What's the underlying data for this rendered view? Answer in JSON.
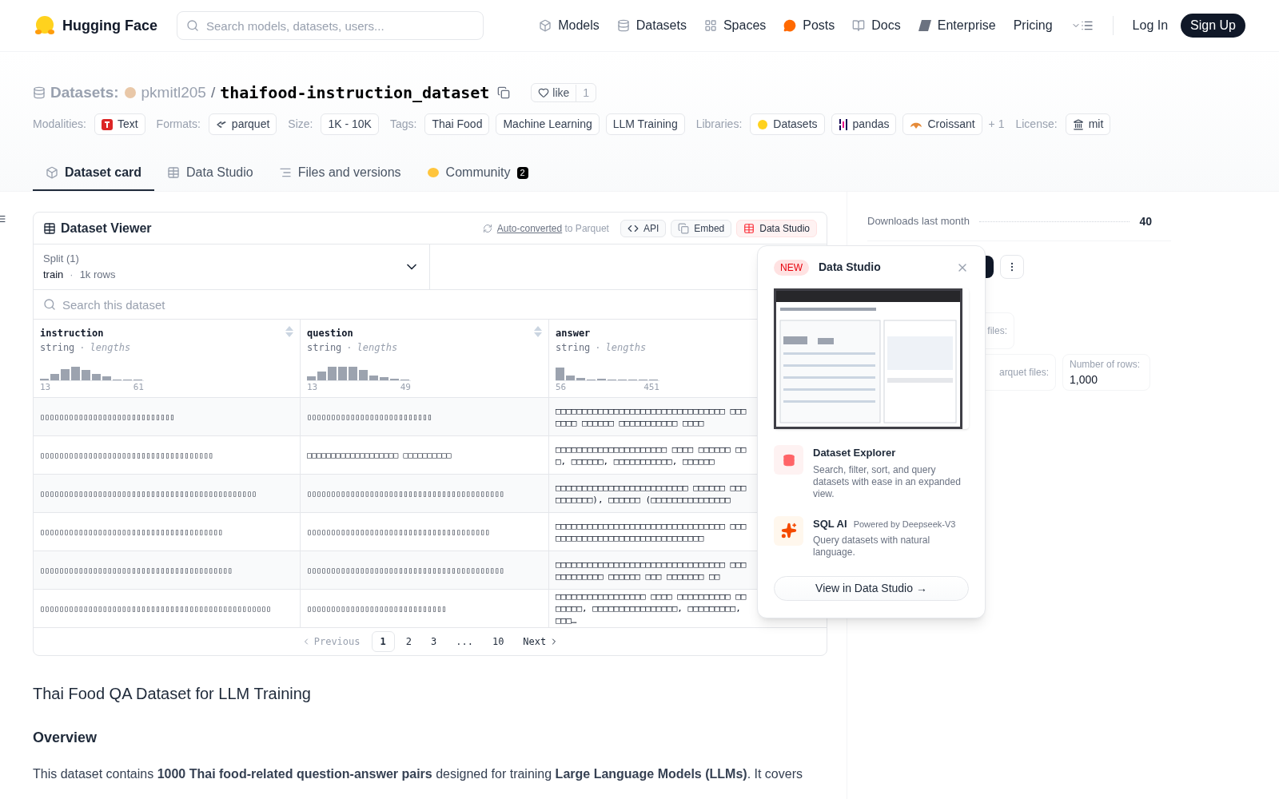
{
  "header": {
    "logo_text": "Hugging Face",
    "search_placeholder": "Search models, datasets, users...",
    "nav": [
      {
        "label": "Models",
        "kind": "models"
      },
      {
        "label": "Datasets",
        "kind": "datasets"
      },
      {
        "label": "Spaces",
        "kind": "spaces"
      },
      {
        "label": "Posts",
        "kind": "posts"
      },
      {
        "label": "Docs",
        "kind": "docs"
      },
      {
        "label": "Enterprise",
        "kind": "enterprise"
      },
      {
        "label": "Pricing",
        "kind": "plain"
      }
    ],
    "login": "Log In",
    "signup": "Sign Up"
  },
  "repo": {
    "category": "Datasets:",
    "owner": "pkmitl205",
    "separator": "/",
    "name": "thaifood-instruction_dataset",
    "like_label": "like",
    "like_count": "1"
  },
  "meta": [
    {
      "label": "Modalities:",
      "tags": [
        {
          "text": "Text",
          "kind": "text"
        }
      ]
    },
    {
      "label": "Formats:",
      "tags": [
        {
          "text": "parquet",
          "kind": "parquet"
        }
      ]
    },
    {
      "label": "Size:",
      "tags": [
        {
          "text": "1K - 10K",
          "kind": "plain"
        }
      ]
    },
    {
      "label": "Tags:",
      "tags": [
        {
          "text": "Thai Food",
          "kind": "plain"
        },
        {
          "text": "Machine Learning",
          "kind": "plain"
        },
        {
          "text": "LLM Training",
          "kind": "plain"
        }
      ]
    },
    {
      "label": "Libraries:",
      "tags": [
        {
          "text": "Datasets",
          "kind": "hf"
        },
        {
          "text": "pandas",
          "kind": "pandas"
        },
        {
          "text": "Croissant",
          "kind": "croissant"
        }
      ],
      "more": "+ 1"
    },
    {
      "label": "License:",
      "tags": [
        {
          "text": "mit",
          "kind": "license"
        }
      ]
    }
  ],
  "tabs": [
    {
      "label": "Dataset card",
      "kind": "card",
      "selected": true
    },
    {
      "label": "Data Studio",
      "kind": "studio",
      "selected": false
    },
    {
      "label": "Files and versions",
      "kind": "files",
      "selected": false
    },
    {
      "label": "Community",
      "kind": "community",
      "selected": false,
      "badge": "2"
    }
  ],
  "viewer": {
    "title": "Dataset Viewer",
    "converted_link": "Auto-converted",
    "converted_rest": "to Parquet",
    "buttons": [
      {
        "label": "API",
        "kind": "api"
      },
      {
        "label": "Embed",
        "kind": "embed"
      },
      {
        "label": "Data Studio",
        "kind": "studio"
      }
    ],
    "split": {
      "label": "Split (1)",
      "value": "train",
      "separator": "·",
      "rows": "1k rows"
    },
    "search_placeholder": "Search this dataset",
    "columns": [
      {
        "name": "instruction",
        "type": "string",
        "separator": "·",
        "stat": "lengths",
        "min": "13",
        "max": "61"
      },
      {
        "name": "question",
        "type": "string",
        "separator": "·",
        "stat": "lengths",
        "min": "13",
        "max": "49"
      },
      {
        "name": "answer",
        "type": "string",
        "separator": "·",
        "stat": "lengths",
        "min": "56",
        "max": "451"
      }
    ],
    "rows": [
      {
        "cells": [
          "▯▯▯▯▯▯▯▯▯▯▯▯▯▯▯▯▯▯▯▯▯▯▯▯▯▯▯▯",
          "▯▯▯▯▯▯▯▯▯▯▯▯▯▯▯▯▯▯▯▯▯▯▯▯▯▯",
          "□□□□□□□□□□□□□□□□□□□□□□□□□□□□□□□□ □□□□□□□ □□□□□□ □□□□□□□□□□□ □□□□"
        ]
      },
      {
        "cells": [
          "▯▯▯▯▯▯▯▯▯▯▯▯▯▯▯▯▯▯▯▯▯▯▯▯▯▯▯▯▯▯▯▯▯▯▯▯",
          "□□□□□□□□□□□□□□□□□□□ □□□□□□□□□□",
          "□□□□□□□□□□□□□□□□□□□□□ □□□□ □□□□□□ □□□, □□□□□□, □□□□□□□□□□□, □□□□□□"
        ]
      },
      {
        "cells": [
          "▯▯▯▯▯▯▯▯▯▯▯▯▯▯▯▯▯▯▯▯▯▯▯▯▯▯▯▯▯▯▯▯▯▯▯▯▯▯▯▯▯▯▯▯▯",
          "▯▯▯▯▯▯▯▯▯▯▯▯▯▯▯▯▯▯▯▯▯▯▯▯▯▯▯▯▯▯▯▯▯▯▯▯▯▯▯▯▯",
          "□□□□□□□□□□□□□□□□□□□□□□□□□ □□□□□□ □□□□□□□□□□), □□□□□□ (□□□□□□□□□□□□□□□"
        ]
      },
      {
        "cells": [
          "▯▯▯▯▯▯▯▯▯▯▯▯▯▯▯▯▯▯▯▯▯▯▯▯▯▯▯▯▯▯▯▯▯▯▯▯▯▯",
          "▯▯▯▯▯▯▯▯▯▯▯▯▯▯▯▯▯▯▯▯▯▯▯▯▯▯▯▯▯▯▯▯▯▯▯▯▯▯",
          "□□□□□□□□□□□□□□□□□□□□□□□□□□□□□□□□ □□□ □□□□□□□□□□□□□□□□□□□□□□□□□□□□"
        ]
      },
      {
        "cells": [
          "▯▯▯▯▯▯▯▯▯▯▯▯▯▯▯▯▯▯▯▯▯▯▯▯▯▯▯▯▯▯▯▯▯▯▯▯▯▯▯▯",
          "▯▯▯▯▯▯▯▯▯▯▯▯▯▯▯▯▯▯▯▯▯▯▯▯▯▯▯▯▯▯▯▯▯▯▯▯▯▯▯▯▯",
          "□□□□□□□□□□□□□□□□□□□□□□□□□□□□□□□□ □□□ □□□□□□□□□ □□□□□□ □□□ □□□□□□□ □□"
        ]
      },
      {
        "cells": [
          "▯▯▯▯▯▯▯▯▯▯▯▯▯▯▯▯▯▯▯▯▯▯▯▯▯▯▯▯▯▯▯▯▯▯▯▯▯▯▯▯▯▯▯▯▯▯▯▯",
          "▯▯▯▯▯▯▯▯▯▯▯▯▯▯▯▯▯▯▯▯▯▯▯▯▯▯▯▯▯",
          "□□□□□□□□□□□□□□□□□ □□□□ □□□□□□□□□□ □□□□□□□, □□□□□□□□□□□□□□□□, □□□□□□□□□, □□□…"
        ]
      }
    ],
    "pagination": [
      {
        "label": "Previous",
        "kind": "prev",
        "disabled": true,
        "selected": false
      },
      {
        "label": "1",
        "kind": "page",
        "disabled": false,
        "selected": true
      },
      {
        "label": "2",
        "kind": "page",
        "disabled": false,
        "selected": false
      },
      {
        "label": "3",
        "kind": "page",
        "disabled": false,
        "selected": false
      },
      {
        "label": "...",
        "kind": "ellipsis",
        "disabled": false,
        "selected": false
      },
      {
        "label": "10",
        "kind": "page",
        "disabled": false,
        "selected": false
      },
      {
        "label": "Next",
        "kind": "next",
        "disabled": false,
        "selected": false
      }
    ]
  },
  "sidebar": {
    "downloads_label": "Downloads last month",
    "downloads_value": "40",
    "cards": [
      {
        "label": "files:"
      },
      {
        "label": "arquet files:"
      },
      {
        "label": "Number of rows:",
        "value": "1,000"
      }
    ]
  },
  "popup": {
    "badge": "NEW",
    "title": "Data Studio",
    "features": [
      {
        "kind": "explorer",
        "title": "Dataset Explorer",
        "description": "Search, filter, sort, and query datasets with ease in an expanded view."
      },
      {
        "kind": "sql",
        "title": "SQL AI",
        "note": "Powered by Deepseek-V3",
        "description": "Query datasets with natural language."
      }
    ],
    "button": "View in Data Studio →"
  },
  "content": {
    "heading": "Thai Food QA Dataset for LLM Training",
    "subheading": "Overview",
    "paragraph": "This dataset contains **1000 Thai food-related question-answer pairs** designed for training **Large Language Models (LLMs)**. It covers"
  }
}
